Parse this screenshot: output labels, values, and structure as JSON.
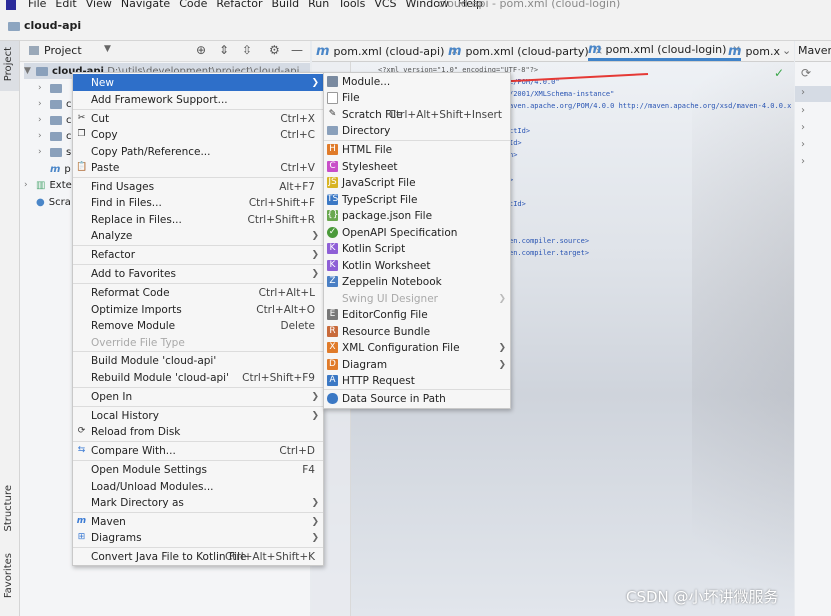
{
  "menubar": {
    "items": [
      "File",
      "Edit",
      "View",
      "Navigate",
      "Code",
      "Refactor",
      "Build",
      "Run",
      "Tools",
      "VCS",
      "Window",
      "Help"
    ],
    "window_title": "cloud-api - pom.xml (cloud-login)"
  },
  "navbar": {
    "project_name": "cloud-api"
  },
  "left_strip": {
    "project": "Project",
    "structure": "Structure",
    "favorites": "Favorites"
  },
  "project_panel": {
    "header_label": "Project",
    "tree": {
      "root_label": "cloud-api",
      "root_path": "D:\\utils\\development\\project\\cloud-api",
      "child_c": "c",
      "child_s": "s",
      "child_p": "p",
      "external_label": "Exte",
      "scratches_label": "Scra"
    }
  },
  "editor": {
    "tabs": [
      {
        "label": "pom.xml (cloud-api)"
      },
      {
        "label": "pom.xml (cloud-party)"
      },
      {
        "label": "pom.xml (cloud-login)"
      },
      {
        "label": "pom.x"
      }
    ],
    "code": {
      "line1": "<?xml version=\"1.0\" encoding=\"UTF-8\"?>",
      "line2": "e/POM/4.0.0\"",
      "line3": "/2001/XMLSchema-instance\"",
      "line4": "aven.apache.org/POM/4.0.0 http://maven.apache.org/xsd/maven-4.0.0.x",
      "line5": "ctId>",
      "line6": "Id>",
      "line7": "n>",
      "line8": ">",
      "line9": "tId>",
      "line10": "en.compiler.source>",
      "line11": "en.compiler.target>"
    }
  },
  "maven": {
    "tab_label": "Maven"
  },
  "context_menu": {
    "items": [
      {
        "label": "New",
        "shortcut": "",
        "submenu": true
      },
      {
        "label": "Add Framework Support...",
        "shortcut": ""
      },
      {
        "label": "Cut",
        "shortcut": "Ctrl+X"
      },
      {
        "label": "Copy",
        "shortcut": "Ctrl+C"
      },
      {
        "label": "Copy Path/Reference...",
        "shortcut": ""
      },
      {
        "label": "Paste",
        "shortcut": "Ctrl+V"
      },
      {
        "label": "Find Usages",
        "shortcut": "Alt+F7"
      },
      {
        "label": "Find in Files...",
        "shortcut": "Ctrl+Shift+F"
      },
      {
        "label": "Replace in Files...",
        "shortcut": "Ctrl+Shift+R"
      },
      {
        "label": "Analyze",
        "shortcut": "",
        "submenu": true
      },
      {
        "label": "Refactor",
        "shortcut": "",
        "submenu": true
      },
      {
        "label": "Add to Favorites",
        "shortcut": "",
        "submenu": true
      },
      {
        "label": "Reformat Code",
        "shortcut": "Ctrl+Alt+L"
      },
      {
        "label": "Optimize Imports",
        "shortcut": "Ctrl+Alt+O"
      },
      {
        "label": "Remove Module",
        "shortcut": "Delete"
      },
      {
        "label": "Override File Type",
        "shortcut": ""
      },
      {
        "label": "Build Module 'cloud-api'",
        "shortcut": ""
      },
      {
        "label": "Rebuild Module 'cloud-api'",
        "shortcut": "Ctrl+Shift+F9"
      },
      {
        "label": "Open In",
        "shortcut": "",
        "submenu": true
      },
      {
        "label": "Local History",
        "shortcut": "",
        "submenu": true
      },
      {
        "label": "Reload from Disk",
        "shortcut": ""
      },
      {
        "label": "Compare With...",
        "shortcut": "Ctrl+D"
      },
      {
        "label": "Open Module Settings",
        "shortcut": "F4"
      },
      {
        "label": "Load/Unload Modules...",
        "shortcut": ""
      },
      {
        "label": "Mark Directory as",
        "shortcut": "",
        "submenu": true
      },
      {
        "label": "Maven",
        "shortcut": "",
        "submenu": true
      },
      {
        "label": "Diagrams",
        "shortcut": "",
        "submenu": true
      },
      {
        "label": "Convert Java File to Kotlin File",
        "shortcut": "Ctrl+Alt+Shift+K"
      }
    ]
  },
  "new_submenu": {
    "items": [
      {
        "label": "Module...",
        "shortcut": ""
      },
      {
        "label": "File",
        "shortcut": ""
      },
      {
        "label": "Scratch File",
        "shortcut": "Ctrl+Alt+Shift+Insert"
      },
      {
        "label": "Directory",
        "shortcut": ""
      },
      {
        "label": "HTML File",
        "shortcut": ""
      },
      {
        "label": "Stylesheet",
        "shortcut": ""
      },
      {
        "label": "JavaScript File",
        "shortcut": ""
      },
      {
        "label": "TypeScript File",
        "shortcut": ""
      },
      {
        "label": "package.json File",
        "shortcut": ""
      },
      {
        "label": "OpenAPI Specification",
        "shortcut": ""
      },
      {
        "label": "Kotlin Script",
        "shortcut": ""
      },
      {
        "label": "Kotlin Worksheet",
        "shortcut": ""
      },
      {
        "label": "Zeppelin Notebook",
        "shortcut": ""
      },
      {
        "label": "Swing UI Designer",
        "shortcut": "",
        "submenu": true
      },
      {
        "label": "EditorConfig File",
        "shortcut": ""
      },
      {
        "label": "Resource Bundle",
        "shortcut": ""
      },
      {
        "label": "XML Configuration File",
        "shortcut": "",
        "submenu": true
      },
      {
        "label": "Diagram",
        "shortcut": "",
        "submenu": true
      },
      {
        "label": "HTTP Request",
        "shortcut": ""
      },
      {
        "label": "Data Source in Path",
        "shortcut": ""
      }
    ]
  },
  "icons": {
    "cut": "scissors-icon",
    "copy": "copy-icon",
    "paste": "clipboard-icon",
    "reload": "reload-icon",
    "compare": "compare-arrows-icon",
    "maven": "maven-icon",
    "diagrams": "diagram-icon"
  },
  "colors": {
    "highlight": "#2e6fc9",
    "accent_blue": "#4083c9",
    "annotation_red": "#e53935"
  },
  "watermark": "CSDN @小坏讲微服务"
}
